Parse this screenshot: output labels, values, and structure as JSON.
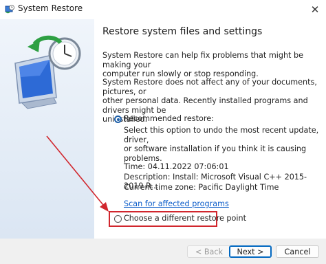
{
  "window": {
    "title": "System Restore",
    "close_glyph": "✕"
  },
  "main": {
    "heading": "Restore system files and settings",
    "intro_line1": "System Restore can help fix problems that might be making your",
    "intro_line2": "computer run slowly or stop responding.",
    "note_line1": "System Restore does not affect any of your documents, pictures, or",
    "note_line2": "other personal data. Recently installed programs and drivers might be",
    "note_line3": "uninstalled.",
    "recommended_label": "Recommended restore:",
    "recommended_desc_line1": "Select this option to undo the most recent update, driver,",
    "recommended_desc_line2": "or software installation if you think it is causing problems.",
    "restore_time": "Time: 04.11.2022 07:06:01",
    "restore_description": "Description: Install: Microsoft Visual C++ 2015-2019 R...",
    "time_zone": "Current time zone: Pacific Daylight Time",
    "scan_link": "Scan for affected programs",
    "different_point_label": "Choose a different restore point"
  },
  "footer": {
    "back_label": "< Back",
    "next_label": "Next >",
    "cancel_label": "Cancel"
  },
  "colors": {
    "accent": "#0067c0",
    "annotation": "#d1262d",
    "link": "#0b5cc9"
  },
  "icons": {
    "app": "system-restore-icon",
    "hero": "computer-clock-restore-icon"
  }
}
